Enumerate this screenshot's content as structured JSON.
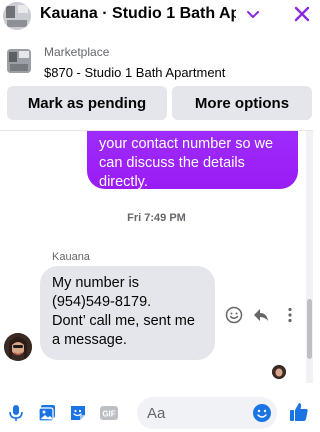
{
  "header": {
    "title": "Kauana · Studio 1 Bath Ap...",
    "accent": "#8a2be2"
  },
  "listing": {
    "marketplace_label": "Marketplace",
    "item": "$870 - Studio 1 Bath Apartment"
  },
  "actions": {
    "pending_label": "Mark as pending",
    "more_label": "More options"
  },
  "chat": {
    "outgoing_lines": [
      "your contact number so we",
      "can discuss the details",
      "directly."
    ],
    "timestamp": "Fri 7:49 PM",
    "sender_name": "Kauana",
    "incoming_lines": [
      "My number is",
      "(954)549-8179.",
      "Dont’ call me, sent me",
      "a message."
    ]
  },
  "composer": {
    "placeholder": "Aa",
    "gif_label": "GIF"
  },
  "colors": {
    "blue": "#1b74e4",
    "outgoing_bubble": "#9b21f5",
    "incoming_bubble": "#e4e6eb"
  }
}
